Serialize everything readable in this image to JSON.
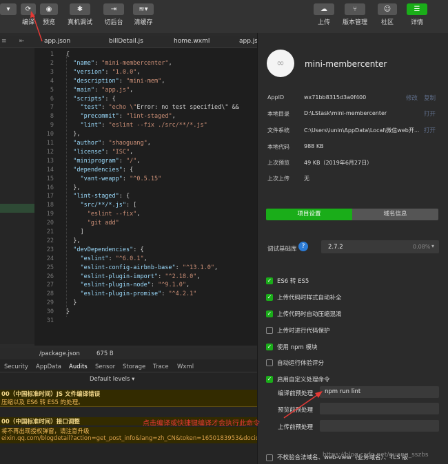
{
  "toolbar": {
    "buttons": [
      {
        "label": "编译"
      },
      {
        "label": "预览"
      },
      {
        "label": "真机调试"
      },
      {
        "label": "切后台"
      },
      {
        "label": "清缓存"
      }
    ],
    "right_buttons": [
      {
        "label": "上传"
      },
      {
        "label": "版本管理"
      },
      {
        "label": "社区"
      },
      {
        "label": "详情"
      }
    ],
    "colors": {
      "accent": "#1aad19",
      "annotation": "#e53935"
    }
  },
  "editor": {
    "tabs": [
      "app.json",
      "billDetail.js",
      "home.wxml",
      "app.js"
    ],
    "lines": [
      "{",
      "  \"name\": \"mini-membercenter\",",
      "  \"version\": \"1.0.0\",",
      "  \"description\": \"mini-mem\",",
      "  \"main\": \"app.js\",",
      "  \"scripts\": {",
      "    \"test\": \"echo \\\"Error: no test specified\\\" &&",
      "    \"precommit\": \"lint-staged\",",
      "    \"lint\": \"eslint --fix ./src/**/*.js\"",
      "  },",
      "  \"author\": \"shaoguang\",",
      "  \"license\": \"ISC\",",
      "  \"miniprogram\": \"/\",",
      "  \"dependencies\": {",
      "    \"vant-weapp\": \"^0.5.15\"",
      "  },",
      "  \"lint-staged\": {",
      "    \"src/**/*.js\": [",
      "      \"eslint --fix\",",
      "      \"git add\"",
      "    ]",
      "  },",
      "  \"devDependencies\": {",
      "    \"eslint\": \"^6.0.1\",",
      "    \"eslint-config-airbnb-base\": \"^13.1.0\",",
      "    \"eslint-plugin-import\": \"^2.18.0\",",
      "    \"eslint-plugin-node\": \"^9.1.0\",",
      "    \"eslint-plugin-promise\": \"^4.2.1\"",
      "  }",
      "}",
      ""
    ],
    "file_path": "/package.json",
    "file_size": "675 B"
  },
  "devtools": {
    "tabs": [
      "Security",
      "AppData",
      "Audits",
      "Sensor",
      "Storage",
      "Trace",
      "Wxml"
    ],
    "levels": "Default levels",
    "logs": [
      {
        "text": "00（中国标准时间）JS 文件编译错误",
        "tone": "warn-bold"
      },
      {
        "text": "压缩以及 ES6 转 ES5 的处理。",
        "tone": "warn"
      },
      {
        "text": "00（中国标准时间）接口调整",
        "tone": "warn-bold"
      },
      {
        "text": "将不再出现授权弹窗，请注意升级",
        "tone": "warn"
      },
      {
        "text": "eixin.qq.com/blogdetail?action=get_post_info&lang=zh_CN&token=1650183953&docid",
        "tone": "link"
      }
    ]
  },
  "details": {
    "project_name": "mini-membercenter",
    "info_rows": [
      {
        "label": "AppID",
        "value": "wx71bb8315d3a0f400"
      },
      {
        "label": "本地目录",
        "value": "D:\\LStask\\mini-membercenter"
      },
      {
        "label": "文件系统",
        "value": "C:\\Users\\iunin\\AppData\\Local\\微信web开..."
      },
      {
        "label": "本地代码",
        "value": "988 KB"
      },
      {
        "label": "上次预览",
        "value": "49 KB（2019年6月27日）"
      },
      {
        "label": "上次上传",
        "value": "无"
      }
    ],
    "links": {
      "modify": "修改",
      "copy": "复制",
      "open1": "打开",
      "open2": "打开"
    },
    "segment": {
      "active": "项目设置",
      "inactive": "域名信息"
    },
    "debug_lib": {
      "label": "调试基础库",
      "help": "?",
      "version": "2.7.2",
      "percent": "0.08%"
    },
    "checkboxes": [
      {
        "label": "ES6 转 ES5",
        "checked": true
      },
      {
        "label": "上传代码时样式自动补全",
        "checked": true
      },
      {
        "label": "上传代码时自动压缩混淆",
        "checked": true
      },
      {
        "label": "上传时进行代码保护",
        "checked": false
      },
      {
        "label": "使用 npm 模块",
        "checked": true
      },
      {
        "label": "自动运行体验评分",
        "checked": false
      },
      {
        "label": "启用自定义处理命令",
        "checked": true
      }
    ],
    "fields": [
      {
        "label": "编译前预处理",
        "value": "npm run lint"
      },
      {
        "label": "预览前预处理",
        "value": ""
      },
      {
        "label": "上传前预处理",
        "value": ""
      }
    ],
    "last_checkbox": {
      "label": "不校验合法域名、web-view（业务域名）、TLS 版"
    }
  },
  "annotation": {
    "text": "点击编译或快捷键编译才会执行此命令"
  },
  "watermark": {
    "text": "https://blog.csdn.net/guang_sszbs"
  }
}
